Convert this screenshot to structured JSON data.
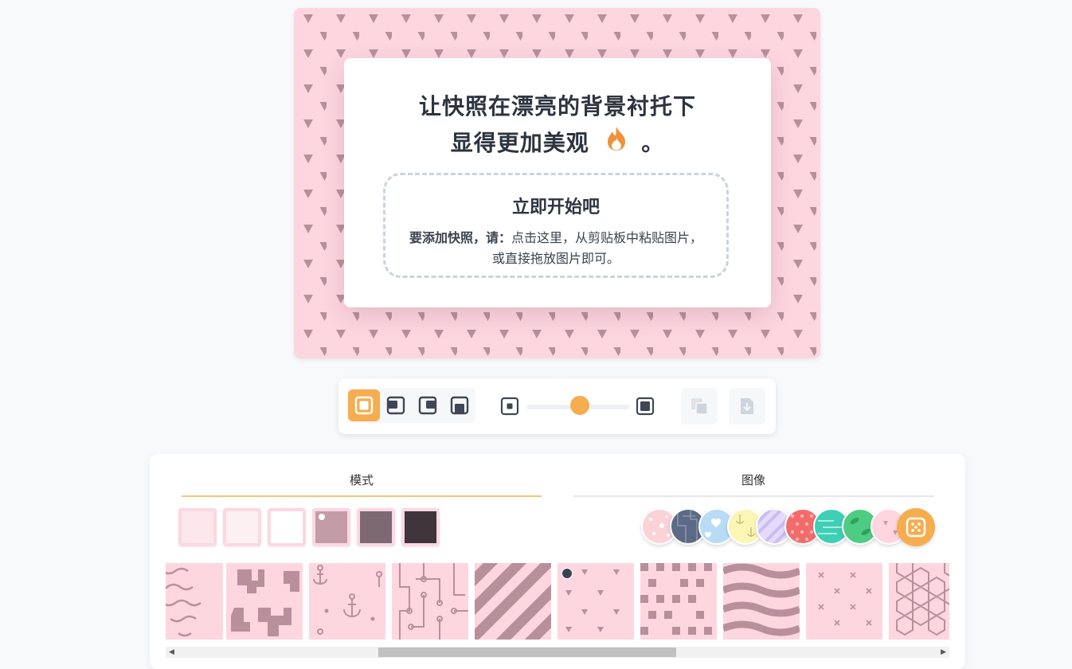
{
  "preview": {
    "headline_line1": "让快照在漂亮的背景衬托下",
    "headline_line2": "显得更加美观",
    "headline_end": "。",
    "headline_icon": "fire-icon",
    "dropzone_title": "立即开始吧",
    "dropzone_bold": "要添加快照，请：",
    "dropzone_text": "点击这里，从剪贴板中粘贴图片，或直接拖放图片即可。",
    "background_color": "#fdd6e0",
    "pattern_color": "#b98f9c"
  },
  "toolbar": {
    "position_buttons": [
      "position-center-icon",
      "position-top-left-icon",
      "position-top-right-icon",
      "position-bottom-icon"
    ],
    "active_position": 0,
    "padding_slider": {
      "min_icon": "padding-small-icon",
      "max_icon": "padding-large-icon",
      "value": 0.5
    },
    "actions": [
      "copy-icon",
      "download-icon"
    ],
    "accent_color": "#f6ad4f"
  },
  "panel": {
    "tabs": [
      {
        "label": "模式"
      },
      {
        "label": "图像"
      }
    ],
    "active_tab": 0,
    "colors": [
      "#fde6ec",
      "#fdf0f3",
      "#ffffff",
      "#c29ca6",
      "#7c6972",
      "#3f353a"
    ],
    "selected_color": 3,
    "image_backgrounds": [
      "pink-dots",
      "slate-circuit",
      "blue-hearts",
      "yellow-anchors",
      "lavender-stripes",
      "coral-polka",
      "teal-waves",
      "green-leaves",
      "pink-triangles"
    ],
    "random_button_icon": "dice-icon",
    "patterns": [
      "wiggle",
      "blobs",
      "anchors",
      "circuit",
      "diagonal-stripes",
      "triangles",
      "checkerboard",
      "waves",
      "crosses",
      "hexagons"
    ],
    "selected_pattern": 5
  }
}
